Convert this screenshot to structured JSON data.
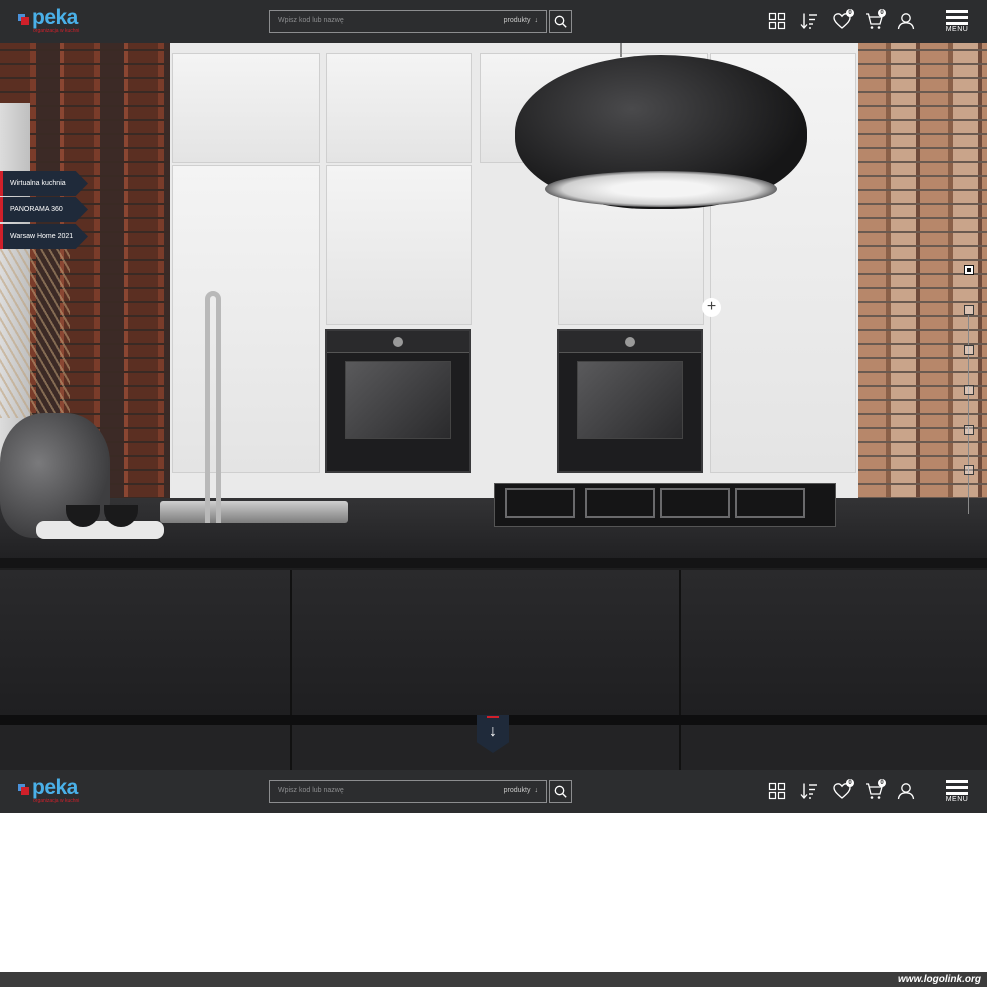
{
  "header": {
    "logo_text": "peka",
    "logo_tagline": "organizacja w kuchni",
    "search_placeholder": "Wpisz kod lub nazwę",
    "search_category": "produkty",
    "search_category_arrow": "↓",
    "icons": [
      "grid-icon",
      "sort-icon",
      "heart-icon",
      "cart-icon",
      "user-icon"
    ],
    "favorites_count": "0",
    "cart_count": "0",
    "menu_label": "MENU"
  },
  "side_tabs": [
    {
      "label": "Wirtualna kuchnia"
    },
    {
      "label": "PANORAMA 360"
    },
    {
      "label": "Warsaw Home 2021"
    }
  ],
  "hotspot_symbol": "+",
  "slides": {
    "count": 6,
    "active": 1
  },
  "scroll_down_symbol": "↓",
  "footer": {
    "watermark": "www.logolink.org"
  },
  "colors": {
    "header_bg": "#2c2d2f",
    "accent_red": "#d0202a",
    "logo_blue": "#4ab0e8",
    "tab_bg": "#1f2a3a"
  }
}
